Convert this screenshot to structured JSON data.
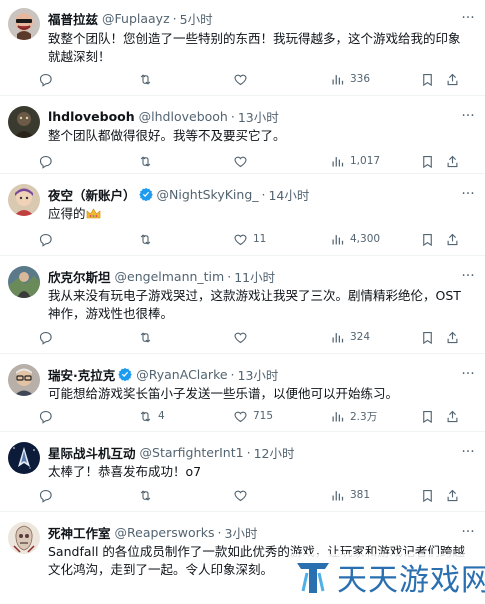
{
  "tweets": [
    {
      "name": "福普拉兹",
      "handle": "@Fuplaayz",
      "time": "5小时",
      "verified": false,
      "text": "致整个团队！您创造了一些特别的东西！我玩得越多，这个游戏给我的印象就越深刻！",
      "counts": {
        "reply": "",
        "retweet": "",
        "like": "",
        "views": "336"
      }
    },
    {
      "name": "lhdlovebooh",
      "handle": "@lhdlovebooh",
      "time": "13小时",
      "verified": false,
      "text": "整个团队都做得很好。我等不及要买它了。",
      "counts": {
        "reply": "",
        "retweet": "",
        "like": "",
        "views": "1,017"
      }
    },
    {
      "name": "夜空（新账户）",
      "handle": "@NightSkyKing_",
      "time": "14小时",
      "verified": true,
      "text": "应得的",
      "emoji": "crown-emoji",
      "counts": {
        "reply": "",
        "retweet": "",
        "like": "11",
        "views": "4,300"
      }
    },
    {
      "name": "欣克尔斯坦",
      "handle": "@engelmann_tim",
      "time": "11小时",
      "verified": false,
      "text": "我从来没有玩电子游戏哭过，这款游戏让我哭了三次。剧情精彩绝伦，OST 神作，游戏性也很棒。",
      "counts": {
        "reply": "",
        "retweet": "",
        "like": "",
        "views": "324"
      }
    },
    {
      "name": "瑞安·克拉克",
      "handle": "@RyanAClarke",
      "time": "13小时",
      "verified": true,
      "text": "可能想给游戏奖长笛小子发送一些乐谱，以便他可以开始练习。",
      "counts": {
        "reply": "",
        "retweet": "4",
        "like": "715",
        "views": "2.3万"
      }
    },
    {
      "name": "星际战斗机互动",
      "handle": "@StarfighterInt1",
      "time": "12小时",
      "verified": false,
      "text": "太棒了！恭喜发布成功！o7",
      "counts": {
        "reply": "",
        "retweet": "",
        "like": "",
        "views": "381"
      }
    },
    {
      "name": "死神工作室",
      "handle": "@Reapersworks",
      "time": "3小时",
      "verified": false,
      "text": "Sandfall 的各位成员制作了一款如此优秀的游戏，让玩家和游戏记者们跨越文化鸿沟，走到了一起。令人印象深刻。",
      "counts": {
        "reply": "",
        "retweet": "",
        "like": "",
        "views": ""
      }
    }
  ],
  "separator": "·",
  "more_glyph": "···",
  "watermark": {
    "text": "天天游戏网"
  },
  "colors": {
    "text": "#0f1419",
    "secondary": "#536471",
    "verified": "#1d9bf0",
    "border": "#eff3f4",
    "watermark": "#2a6fb0"
  },
  "icons": [
    "reply-icon",
    "retweet-icon",
    "like-icon",
    "views-icon",
    "bookmark-icon",
    "share-icon",
    "more-icon",
    "verified-badge-icon"
  ]
}
